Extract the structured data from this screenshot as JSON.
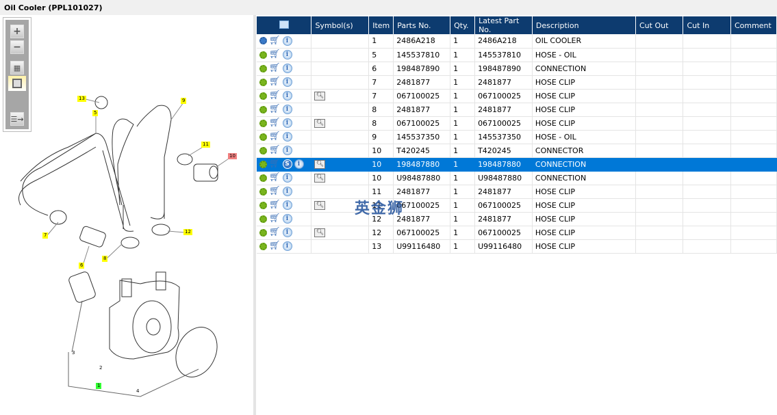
{
  "title": "Oil Cooler (PPL101027)",
  "toolbar": {
    "zoom_in": "+",
    "zoom_out": "−"
  },
  "callouts": [
    {
      "label": "13",
      "style": ""
    },
    {
      "label": "5",
      "style": ""
    },
    {
      "label": "9",
      "style": ""
    },
    {
      "label": "11",
      "style": ""
    },
    {
      "label": "10",
      "style": "red"
    },
    {
      "label": "7",
      "style": ""
    },
    {
      "label": "12",
      "style": ""
    },
    {
      "label": "8",
      "style": ""
    },
    {
      "label": "6",
      "style": ""
    },
    {
      "label": "3",
      "style": "plain"
    },
    {
      "label": "2",
      "style": "plain"
    },
    {
      "label": "1",
      "style": "green"
    },
    {
      "label": "4",
      "style": "plain"
    }
  ],
  "table": {
    "headers": [
      "",
      "Symbol(s)",
      "Item",
      "Parts No.",
      "Qty.",
      "Latest Part No.",
      "Description",
      "Cut Out",
      "Cut In",
      "Comment"
    ],
    "rows": [
      {
        "item": "1",
        "part": "2486A218",
        "qty": "1",
        "latest": "2486A218",
        "desc": "OIL COOLER",
        "book": false,
        "multi": true
      },
      {
        "item": "5",
        "part": "145537810",
        "qty": "1",
        "latest": "145537810",
        "desc": "HOSE - OIL",
        "book": false
      },
      {
        "item": "6",
        "part": "198487890",
        "qty": "1",
        "latest": "198487890",
        "desc": "CONNECTION",
        "book": false
      },
      {
        "item": "7",
        "part": "2481877",
        "qty": "1",
        "latest": "2481877",
        "desc": "HOSE CLIP",
        "book": false
      },
      {
        "item": "7",
        "part": "067100025",
        "qty": "1",
        "latest": "067100025",
        "desc": "HOSE CLIP",
        "book": true
      },
      {
        "item": "8",
        "part": "2481877",
        "qty": "1",
        "latest": "2481877",
        "desc": "HOSE CLIP",
        "book": false
      },
      {
        "item": "8",
        "part": "067100025",
        "qty": "1",
        "latest": "067100025",
        "desc": "HOSE CLIP",
        "book": true
      },
      {
        "item": "9",
        "part": "145537350",
        "qty": "1",
        "latest": "145537350",
        "desc": "HOSE - OIL",
        "book": false
      },
      {
        "item": "10",
        "part": "T420245",
        "qty": "1",
        "latest": "T420245",
        "desc": "CONNECTOR",
        "book": false
      },
      {
        "item": "10",
        "part": "198487880",
        "qty": "1",
        "latest": "198487880",
        "desc": "CONNECTION",
        "book": true,
        "selected": true,
        "s": "S"
      },
      {
        "item": "10",
        "part": "U98487880",
        "qty": "1",
        "latest": "U98487880",
        "desc": "CONNECTION",
        "book": true
      },
      {
        "item": "11",
        "part": "2481877",
        "qty": "1",
        "latest": "2481877",
        "desc": "HOSE CLIP",
        "book": false
      },
      {
        "item": "11",
        "part": "067100025",
        "qty": "1",
        "latest": "067100025",
        "desc": "HOSE CLIP",
        "book": true
      },
      {
        "item": "12",
        "part": "2481877",
        "qty": "1",
        "latest": "2481877",
        "desc": "HOSE CLIP",
        "book": false
      },
      {
        "item": "12",
        "part": "067100025",
        "qty": "1",
        "latest": "067100025",
        "desc": "HOSE CLIP",
        "book": true
      },
      {
        "item": "13",
        "part": "U99116480",
        "qty": "1",
        "latest": "U99116480",
        "desc": "HOSE CLIP",
        "book": false
      }
    ]
  },
  "watermark": "英金狮",
  "colors": {
    "header": "#0d3b6f",
    "selected": "#0078d7"
  }
}
